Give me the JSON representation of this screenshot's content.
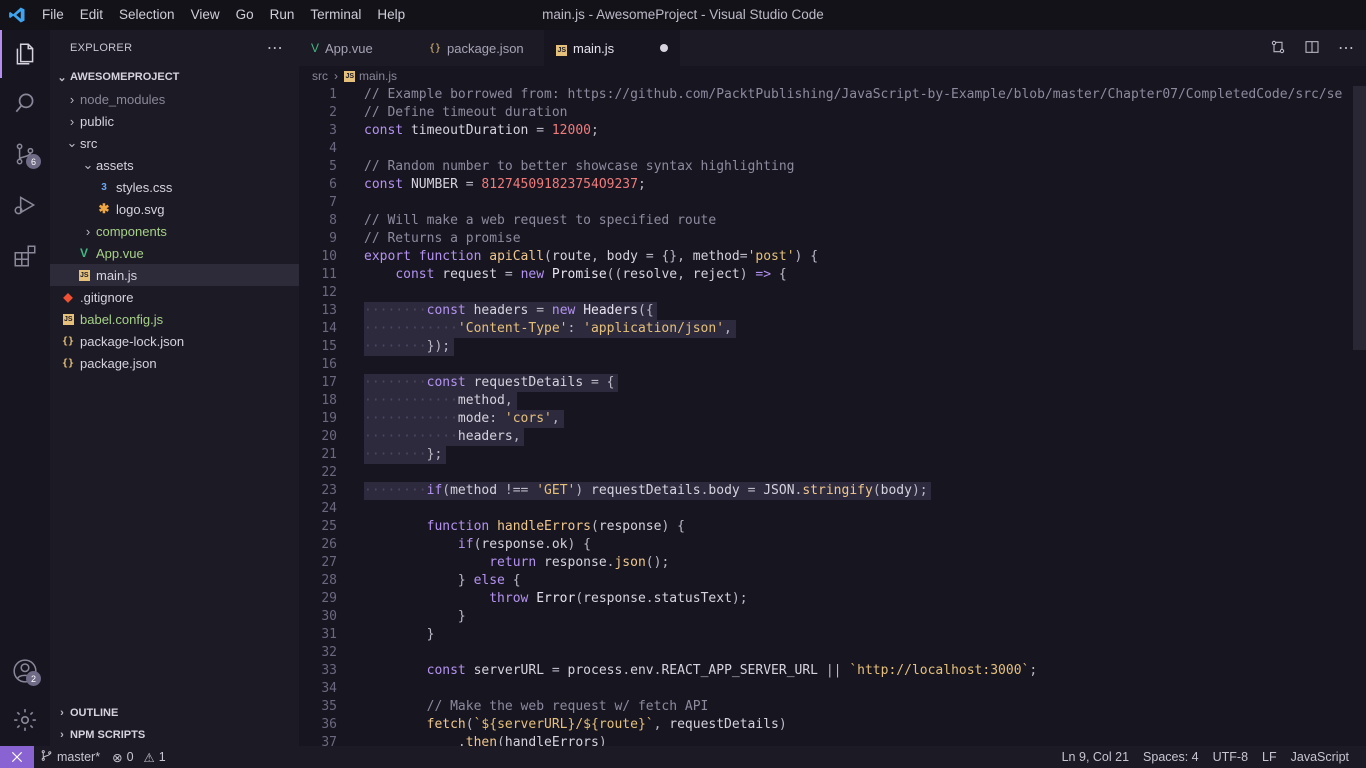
{
  "titlebar": {
    "menu": [
      "File",
      "Edit",
      "Selection",
      "View",
      "Go",
      "Run",
      "Terminal",
      "Help"
    ],
    "title": "main.js - AwesomeProject - Visual Studio Code"
  },
  "activitybar": {
    "items": [
      "explorer-icon",
      "search-icon",
      "source-control-icon",
      "run-debug-icon",
      "extensions-icon"
    ],
    "scm_badge": "6",
    "accounts_badge": "2"
  },
  "sidebar": {
    "title": "EXPLORER",
    "project": "AWESOMEPROJECT",
    "tree": {
      "node_modules": "node_modules",
      "public": "public",
      "src": "src",
      "assets": "assets",
      "styles_css": "styles.css",
      "logo_svg": "logo.svg",
      "components": "components",
      "app_vue": "App.vue",
      "main_js": "main.js",
      "gitignore": ".gitignore",
      "babel_config": "babel.config.js",
      "package_lock": "package-lock.json",
      "package_json": "package.json"
    },
    "outline": "OUTLINE",
    "npm_scripts": "NPM SCRIPTS"
  },
  "tabs": [
    {
      "label": "App.vue",
      "icon": "vue-icon"
    },
    {
      "label": "package.json",
      "icon": "json-icon"
    },
    {
      "label": "main.js",
      "icon": "js-icon",
      "active": true,
      "dirty": true
    }
  ],
  "breadcrumb": [
    "src",
    "main.js"
  ],
  "editor": {
    "lines": [
      "// Example borrowed from: https://github.com/PacktPublishing/JavaScript-by-Example/blob/master/Chapter07/CompletedCode/src/se",
      "// Define timeout duration",
      "const timeoutDuration = 12000;",
      "",
      "// Random number to better showcase syntax highlighting",
      "const NUMBER = 812745091823754O9237;",
      "",
      "// Will make a web request to specified route",
      "// Returns a promise",
      "export function apiCall(route, body = {}, method='post') {",
      "const request = new Promise((resolve, reject) => {",
      "",
      "const headers = new Headers({",
      "'Content-Type': 'application/json',",
      "});",
      "",
      "const requestDetails = {",
      "method,",
      "mode: 'cors',",
      "headers,",
      "};",
      "",
      "if(method !== 'GET') requestDetails.body = JSON.stringify(body);",
      "",
      "function handleErrors(response) {",
      "if(response.ok) {",
      "return response.json();",
      "} else {",
      "throw Error(response.statusText);",
      "}",
      "}",
      "",
      "const serverURL = process.env.REACT_APP_SERVER_URL || `http://localhost:3000`;",
      "",
      "// Make the web request w/ fetch API",
      "fetch(`${serverURL}/${route}`, requestDetails)",
      ".then(handleErrors)"
    ]
  },
  "statusbar": {
    "branch": "master*",
    "errors": "0",
    "warnings": "1",
    "position": "Ln 9, Col 21",
    "spaces": "Spaces: 4",
    "encoding": "UTF-8",
    "eol": "LF",
    "language": "JavaScript"
  },
  "colors": {
    "accent": "#b58cf0",
    "remote": "#8a63d2",
    "background": "#171520"
  }
}
